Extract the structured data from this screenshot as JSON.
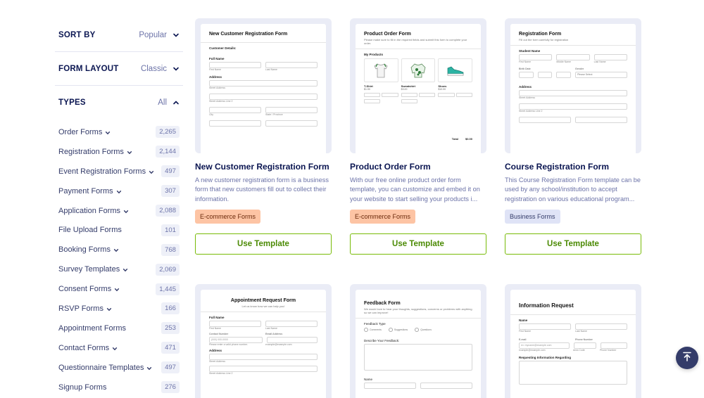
{
  "sidebar": {
    "sort": {
      "title": "SORT BY",
      "value": "Popular"
    },
    "layout": {
      "title": "FORM LAYOUT",
      "value": "Classic"
    },
    "types": {
      "title": "TYPES",
      "value": "All"
    },
    "items": [
      {
        "label": "Order Forms",
        "count": "2,265",
        "expandable": true
      },
      {
        "label": "Registration Forms",
        "count": "2,144",
        "expandable": true
      },
      {
        "label": "Event Registration Forms",
        "count": "497",
        "expandable": true
      },
      {
        "label": "Payment Forms",
        "count": "307",
        "expandable": true
      },
      {
        "label": "Application Forms",
        "count": "2,088",
        "expandable": true
      },
      {
        "label": "File Upload Forms",
        "count": "101",
        "expandable": false
      },
      {
        "label": "Booking Forms",
        "count": "768",
        "expandable": true
      },
      {
        "label": "Survey Templates",
        "count": "2,069",
        "expandable": true
      },
      {
        "label": "Consent Forms",
        "count": "1,445",
        "expandable": true
      },
      {
        "label": "RSVP Forms",
        "count": "166",
        "expandable": true
      },
      {
        "label": "Appointment Forms",
        "count": "253",
        "expandable": false
      },
      {
        "label": "Contact Forms",
        "count": "471",
        "expandable": true
      },
      {
        "label": "Questionnaire Templates",
        "count": "497",
        "expandable": true
      },
      {
        "label": "Signup Forms",
        "count": "276",
        "expandable": false
      }
    ]
  },
  "cards": [
    {
      "title": "New Customer Registration Form",
      "description": "A new customer registration form is a business form that new customers fill out to collect their information.",
      "tag": "E-commerce Forms",
      "button": "Use Template",
      "preview": {
        "title": "New Customer Registration Form",
        "section": "Customer Details:",
        "l1": "Full Name",
        "c1": "First Name",
        "c2": "Last Name",
        "l2": "Address",
        "c3": "Street Address",
        "c4": "Street Address Line 2",
        "c5": "City",
        "c6": "State / Province"
      }
    },
    {
      "title": "Product Order Form",
      "description": "With our free online product order form template, you can customize and embed it on your website to start selling your products i...",
      "tag": "E-commerce Forms",
      "button": "Use Template",
      "preview": {
        "title": "Product Order Form",
        "sub": "Please make sure to fill in the required fields and submit this form to complete your order.",
        "section": "My Products",
        "p1": "T-Shirt",
        "p1price": "$1.00",
        "p2": "Sweatshirt",
        "p2price": "$3.00",
        "p3": "Shoes",
        "p3price": "$10.00",
        "total_label": "Total",
        "total_value": "$0.00"
      }
    },
    {
      "title": "Course Registration Form",
      "description": "This Course Registration Form template can be used by any school/institution to accept registration on various educational program...",
      "tag": "Business Forms",
      "button": "Use Template",
      "preview": {
        "title": "Registration Form",
        "sub": "Fill out the form carefully for registration",
        "l1": "Student Name",
        "c1": "First Name",
        "c2": "Middle Name",
        "c3": "Last Name",
        "l2": "Birth Date",
        "l3": "Gender",
        "s1": "Please Select",
        "l4": "Address",
        "c4": "Street Address",
        "c5": "Street Address Line 2"
      }
    },
    {
      "preview": {
        "title": "Appointment Request Form",
        "sub": "Let us know how we can help you!",
        "l1": "Full Name",
        "c1": "First Name",
        "c2": "Last Name",
        "l2": "Contact Number",
        "l3": "Email Address",
        "ph1": "(000) 000-0000",
        "c3": "Please enter a valid phone number.",
        "c4": "example@example.com",
        "l4": "Address",
        "c5": "Street Address",
        "c6": "Street Address Line 2"
      }
    },
    {
      "preview": {
        "title": "Feedback Form",
        "sub": "We would love to hear your thoughts, suggestions, concerns or problems with anything so we can improve!",
        "l1": "Feedback Type",
        "r1": "Comments",
        "r2": "Suggestions",
        "r3": "Questions",
        "l2": "Describe Your Feedback:",
        "l3": "Name"
      }
    },
    {
      "preview": {
        "title": "Information Request",
        "l1": "Name",
        "c1": "First Name",
        "c2": "Last Name",
        "l2": "E-mail",
        "l3": "Phone Number",
        "ph1": "ex: myname@example.com",
        "c3": "example@example.com",
        "c4": "Area Code",
        "c5": "Phone Number",
        "l4": "Requesting Information Regarding"
      }
    }
  ],
  "scroll_top": {
    "icon": "arrow-up-to-line-icon"
  },
  "colors": {
    "accent_green": "#78bb07",
    "navy": "#0a1551",
    "ecommerce_tag": "#fdc4a4",
    "business_tag": "#dfe3f6"
  }
}
